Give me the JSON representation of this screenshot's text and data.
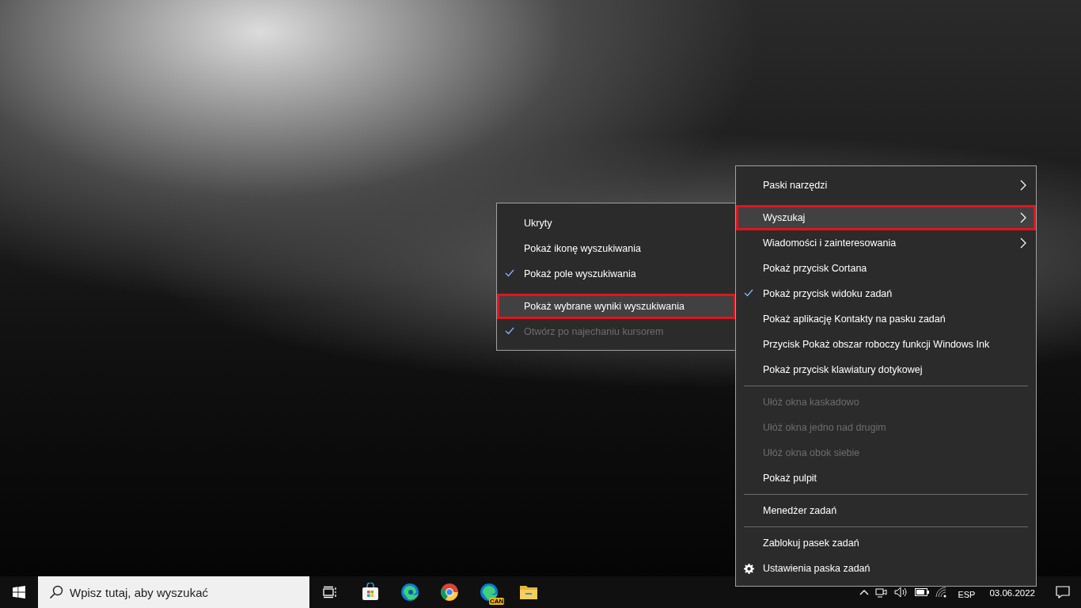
{
  "context_menu": {
    "items": [
      {
        "kind": "item",
        "label": "Paski narzędzi",
        "submenu": true,
        "checked": false,
        "disabled": false,
        "selected": false,
        "annotated": false
      },
      {
        "kind": "item",
        "label": "Wyszukaj",
        "submenu": true,
        "checked": false,
        "disabled": false,
        "selected": true,
        "annotated": true
      },
      {
        "kind": "item",
        "label": "Wiadomości i zainteresowania",
        "submenu": true,
        "checked": false,
        "disabled": false,
        "selected": false,
        "annotated": false
      },
      {
        "kind": "item",
        "label": "Pokaż przycisk Cortana",
        "submenu": false,
        "checked": false,
        "disabled": false,
        "selected": false,
        "annotated": false
      },
      {
        "kind": "item",
        "label": "Pokaż przycisk widoku zadań",
        "submenu": false,
        "checked": true,
        "disabled": false,
        "selected": false,
        "annotated": false
      },
      {
        "kind": "item",
        "label": "Pokaż aplikację Kontakty na pasku zadań",
        "submenu": false,
        "checked": false,
        "disabled": false,
        "selected": false,
        "annotated": false
      },
      {
        "kind": "item",
        "label": "Przycisk Pokaż obszar roboczy funkcji Windows Ink",
        "submenu": false,
        "checked": false,
        "disabled": false,
        "selected": false,
        "annotated": false
      },
      {
        "kind": "item",
        "label": "Pokaż przycisk klawiatury dotykowej",
        "submenu": false,
        "checked": false,
        "disabled": false,
        "selected": false,
        "annotated": false
      },
      {
        "kind": "separator"
      },
      {
        "kind": "item",
        "label": "Ułóż okna kaskadowo",
        "submenu": false,
        "checked": false,
        "disabled": true,
        "selected": false,
        "annotated": false
      },
      {
        "kind": "item",
        "label": "Ułóż okna jedno nad drugim",
        "submenu": false,
        "checked": false,
        "disabled": true,
        "selected": false,
        "annotated": false
      },
      {
        "kind": "item",
        "label": "Ułóż okna obok siebie",
        "submenu": false,
        "checked": false,
        "disabled": true,
        "selected": false,
        "annotated": false
      },
      {
        "kind": "item",
        "label": "Pokaż pulpit",
        "submenu": false,
        "checked": false,
        "disabled": false,
        "selected": false,
        "annotated": false
      },
      {
        "kind": "separator"
      },
      {
        "kind": "item",
        "label": "Menedżer zadań",
        "submenu": false,
        "checked": false,
        "disabled": false,
        "selected": false,
        "annotated": false
      },
      {
        "kind": "separator"
      },
      {
        "kind": "item",
        "label": "Zablokuj pasek zadań",
        "submenu": false,
        "checked": false,
        "disabled": false,
        "selected": false,
        "annotated": false
      },
      {
        "kind": "settings",
        "label": "Ustawienia paska zadań",
        "submenu": false,
        "checked": false,
        "disabled": false,
        "selected": false,
        "annotated": false
      }
    ]
  },
  "search_submenu": {
    "items": [
      {
        "kind": "item",
        "label": "Ukryty",
        "checked": false,
        "disabled": false,
        "selected": false,
        "annotated": false
      },
      {
        "kind": "item",
        "label": "Pokaż ikonę wyszukiwania",
        "checked": false,
        "disabled": false,
        "selected": false,
        "annotated": false
      },
      {
        "kind": "item",
        "label": "Pokaż pole wyszukiwania",
        "checked": true,
        "disabled": false,
        "selected": false,
        "annotated": false
      },
      {
        "kind": "item",
        "label": "Pokaż wybrane wyniki wyszukiwania",
        "checked": false,
        "disabled": false,
        "selected": true,
        "annotated": true
      },
      {
        "kind": "item",
        "label": "Otwórz po najechaniu kursorem",
        "checked": true,
        "disabled": true,
        "selected": false,
        "annotated": false
      }
    ]
  },
  "taskbar": {
    "search": {
      "placeholder": "Wpisz tutaj, aby wyszukać"
    },
    "app_badge": "CAN",
    "language": "ESP",
    "date": "03.06.2022"
  }
}
